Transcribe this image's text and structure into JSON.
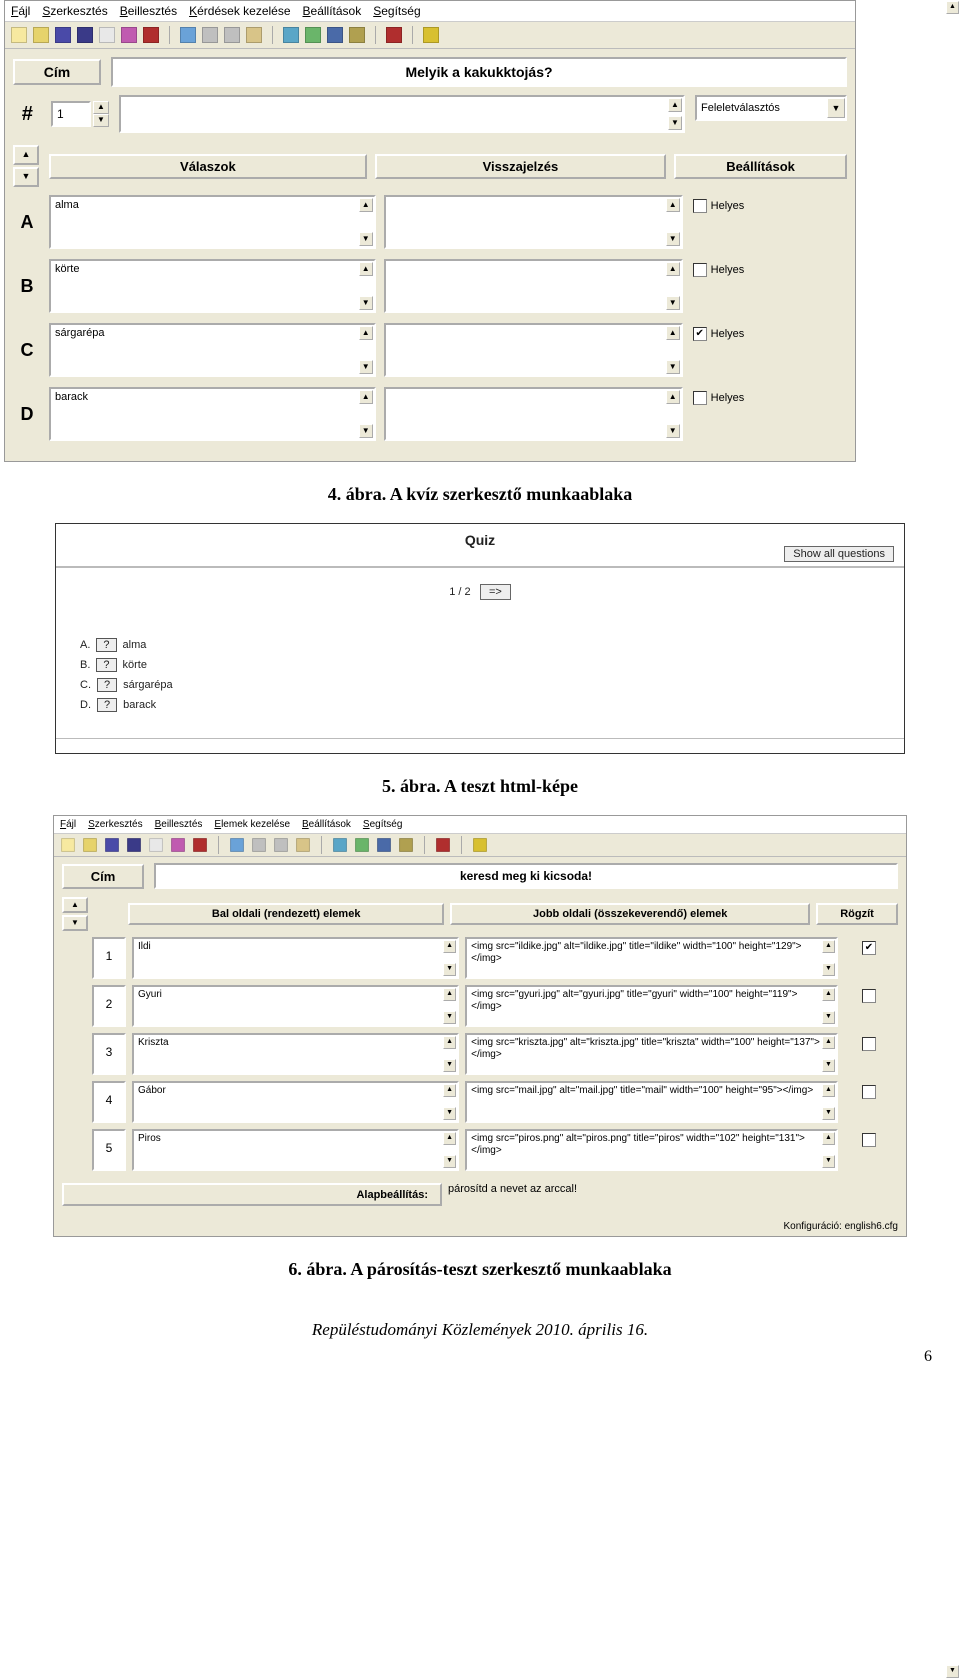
{
  "fig1": {
    "menus": [
      "Fájl",
      "Szerkesztés",
      "Beillesztés",
      "Kérdések kezelése",
      "Beállítások",
      "Segítség"
    ],
    "title_label": "Cím",
    "title_value": "Melyik a kakukktojás?",
    "hash_label": "#",
    "q_number": "1",
    "q_text": "",
    "qtype": "Feleletválasztós",
    "col_headers": {
      "answers": "Válaszok",
      "feedback": "Visszajelzés",
      "settings": "Beállítások"
    },
    "correct_label": "Helyes",
    "rows": [
      {
        "label": "A",
        "answer": "alma",
        "feedback": "",
        "correct": false
      },
      {
        "label": "B",
        "answer": "körte",
        "feedback": "",
        "correct": false
      },
      {
        "label": "C",
        "answer": "sárgarépa",
        "feedback": "",
        "correct": true
      },
      {
        "label": "D",
        "answer": "barack",
        "feedback": "",
        "correct": false
      }
    ]
  },
  "caption1": "4. ábra. A kvíz szerkesztő munkaablaka",
  "fig2": {
    "title": "Quiz",
    "show_all": "Show all questions",
    "counter": "1 / 2",
    "next": "=>",
    "options": [
      {
        "label": "A.",
        "btn": "?",
        "text": "alma"
      },
      {
        "label": "B.",
        "btn": "?",
        "text": "körte"
      },
      {
        "label": "C.",
        "btn": "?",
        "text": "sárgarépa"
      },
      {
        "label": "D.",
        "btn": "?",
        "text": "barack"
      }
    ]
  },
  "caption2": "5. ábra. A teszt html-képe",
  "fig3": {
    "menus": [
      "Fájl",
      "Szerkesztés",
      "Beillesztés",
      "Elemek kezelése",
      "Beállítások",
      "Segítség"
    ],
    "title_label": "Cím",
    "title_value": "keresd meg ki kicsoda!",
    "col_headers": {
      "left": "Bal oldali (rendezett) elemek",
      "right": "Jobb oldali (összekeverendő) elemek",
      "fix": "Rögzít"
    },
    "rows": [
      {
        "idx": "1",
        "left": "Ildi",
        "right": "<img src=\"ildike.jpg\" alt=\"ildike.jpg\" title=\"ildike\" width=\"100\" height=\"129\"></img>",
        "fix": true
      },
      {
        "idx": "2",
        "left": "Gyuri",
        "right": "<img src=\"gyuri.jpg\" alt=\"gyuri.jpg\" title=\"gyuri\" width=\"100\" height=\"119\"></img>",
        "fix": false
      },
      {
        "idx": "3",
        "left": "Kriszta",
        "right": "<img src=\"kriszta.jpg\" alt=\"kriszta.jpg\" title=\"kriszta\" width=\"100\" height=\"137\"></img>",
        "fix": false
      },
      {
        "idx": "4",
        "left": "Gábor",
        "right": "<img src=\"mail.jpg\" alt=\"mail.jpg\" title=\"mail\" width=\"100\" height=\"95\"></img>",
        "fix": false
      },
      {
        "idx": "5",
        "left": "Piros",
        "right": "<img src=\"piros.png\" alt=\"piros.png\" title=\"piros\" width=\"102\" height=\"131\"></img>",
        "fix": false
      }
    ],
    "default_label": "Alapbeállítás:",
    "default_value": "párosítd a nevet az arccal!",
    "status": "Konfiguráció: english6.cfg"
  },
  "caption3": "6. ábra. A párosítás-teszt szerkesztő munkaablaka",
  "footer": "Repüléstudományi Közlemények 2010. április 16.",
  "pagenum": "6",
  "toolbar_icons": [
    {
      "name": "new-icon",
      "c": "#f7e9a0"
    },
    {
      "name": "open-icon",
      "c": "#e6d36b"
    },
    {
      "name": "save-icon",
      "c": "#4a4aa8"
    },
    {
      "name": "save-all-icon",
      "c": "#3a3a88"
    },
    {
      "name": "print-icon",
      "c": "#e8e8e8"
    },
    {
      "name": "export-pkg-icon",
      "c": "#c05bb0"
    },
    {
      "name": "export-web-icon",
      "c": "#b02e2e"
    },
    {
      "name": "sep"
    },
    {
      "name": "undo-icon",
      "c": "#6aa2d8"
    },
    {
      "name": "cut-icon",
      "c": "#bfbfbf"
    },
    {
      "name": "copy-icon",
      "c": "#bfbfbf"
    },
    {
      "name": "paste-icon",
      "c": "#d8c488"
    },
    {
      "name": "sep"
    },
    {
      "name": "tool1-icon",
      "c": "#5aa6c7"
    },
    {
      "name": "tool2-icon",
      "c": "#6ab56a"
    },
    {
      "name": "tool3-icon",
      "c": "#4a6aa8"
    },
    {
      "name": "tool4-icon",
      "c": "#b0a050"
    },
    {
      "name": "sep"
    },
    {
      "name": "run-icon",
      "c": "#b02e2e"
    },
    {
      "name": "sep"
    },
    {
      "name": "help-icon",
      "c": "#d8c030"
    }
  ]
}
